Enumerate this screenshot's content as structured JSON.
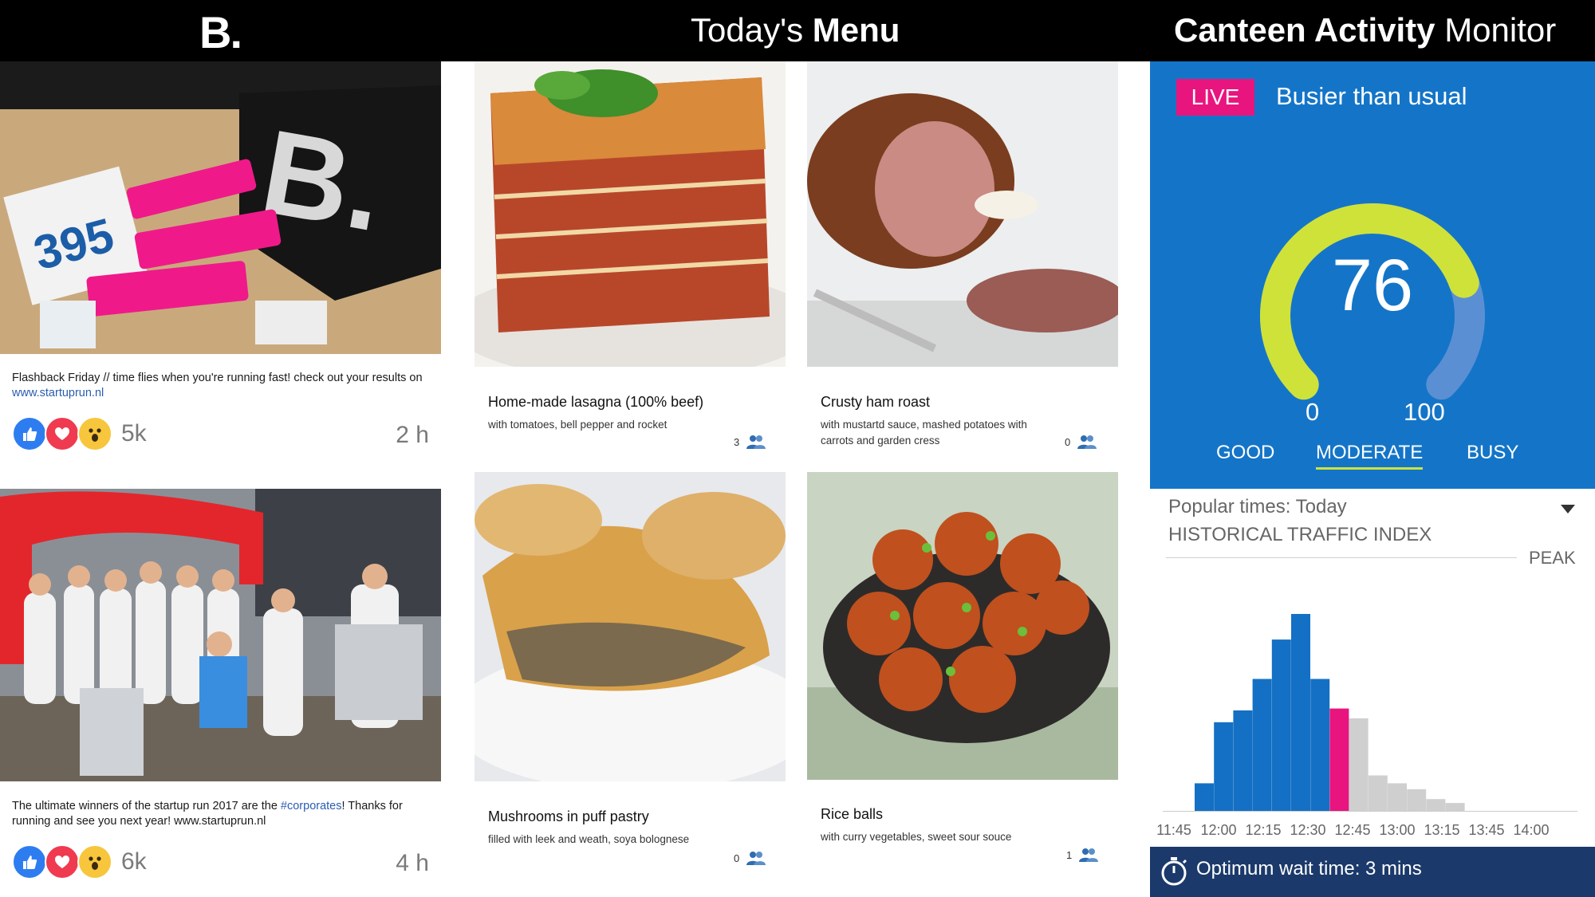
{
  "header": {
    "logo": "B.",
    "menu_title_regular": "Today's ",
    "menu_title_bold": "Menu",
    "monitor_title_bold": "Canteen Activity",
    "monitor_title_regular": " Monitor"
  },
  "feed": {
    "posts": [
      {
        "text": "Flashback Friday // time flies when you're running fast! check out your results on ",
        "link": "www.startuprun.nl",
        "reactions": [
          "like",
          "love",
          "wow"
        ],
        "count": "5k",
        "time": "2 h"
      },
      {
        "text_before": "The ultimate winners of the startup run 2017 are the ",
        "hashtag": "#corporates",
        "text_after": "! Thanks for running and see you next year!  www.startuprun.nl",
        "reactions": [
          "like",
          "love",
          "wow"
        ],
        "count": "6k",
        "time": "4 h"
      }
    ]
  },
  "menu": {
    "items": [
      {
        "name": "Home-made lasagna (100% beef)",
        "description": "with tomatoes, bell pepper and rocket",
        "count": "3"
      },
      {
        "name": "Crusty ham roast",
        "description": "with mustartd sauce, mashed potatoes with carrots and garden cress",
        "count": "0"
      },
      {
        "name": "Mushrooms in puff pastry",
        "description": "filled with leek and weath, soya bolognese",
        "count": "0"
      },
      {
        "name": "Rice balls",
        "description": "with curry vegetables, sweet sour souce",
        "count": "1"
      }
    ]
  },
  "monitor": {
    "live_label": "LIVE",
    "status_text": "Busier than usual",
    "gauge": {
      "value": "76",
      "min": "0",
      "max": "100",
      "fill_fraction": 0.76
    },
    "levels": [
      "GOOD",
      "MODERATE",
      "BUSY"
    ],
    "active_level": "MODERATE",
    "popular_times": "Popular times: Today",
    "historical_label": "HISTORICAL TRAFFIC INDEX",
    "peak_label": "PEAK",
    "wait_text": "Optimum wait time: 3 mins",
    "colors": {
      "panel": "#1475c8",
      "accent": "#e8157f",
      "gauge_fill": "#cfe23a",
      "gauge_track": "#5b8fd3",
      "bar": "#1470c4",
      "bar_future": "#cfcfcf"
    }
  },
  "chart_data": {
    "type": "bar",
    "title": "HISTORICAL TRAFFIC INDEX",
    "tick_labels": [
      "11:45",
      "12:00",
      "12:15",
      "12:30",
      "12:45",
      "13:00",
      "13:15",
      "13:45",
      "14:00"
    ],
    "values": [
      14,
      45,
      51,
      67,
      87,
      100,
      67,
      52,
      47,
      18,
      14,
      11,
      6,
      4
    ],
    "states": [
      "past",
      "past",
      "past",
      "past",
      "past",
      "past",
      "past",
      "current",
      "future",
      "future",
      "future",
      "future",
      "future",
      "future"
    ],
    "ylim": [
      0,
      100
    ],
    "grid": false
  }
}
